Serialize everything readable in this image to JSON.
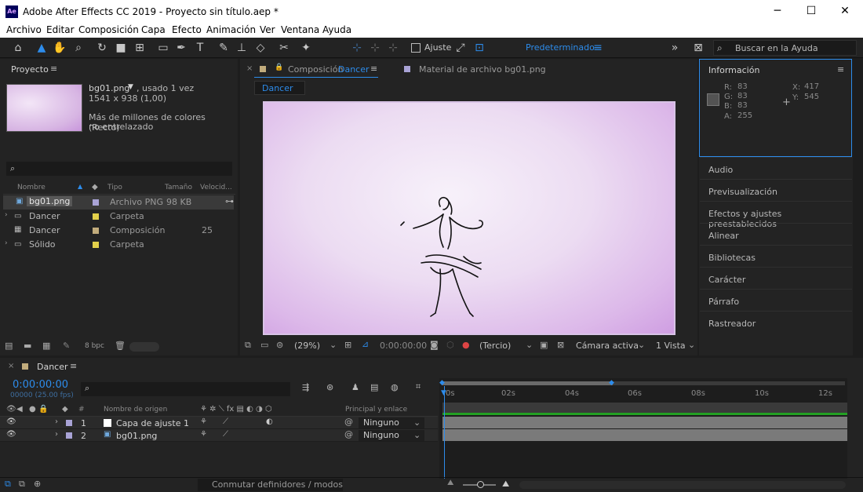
{
  "window": {
    "title": "Adobe After Effects CC 2019 - Proyecto sin título.aep *",
    "logo": "Ae",
    "minimize": "─",
    "maximize": "☐",
    "close": "✕"
  },
  "menu": [
    "Archivo",
    "Editar",
    "Composición",
    "Capa",
    "Efecto",
    "Animación",
    "Ver",
    "Ventana",
    "Ayuda"
  ],
  "toolbar": {
    "snap_label": "Ajuste",
    "workspace": "Predeterminado",
    "search_placeholder": "Buscar en la Ayuda"
  },
  "project": {
    "title": "Proyecto",
    "selected_name": "bg01.png",
    "used": ", usado 1 vez",
    "dimensions": "1541 x 938 (1,00)",
    "color_info": "Más de millones de colores (Recto)",
    "interlace": "no entrelazado",
    "columns": {
      "name": "Nombre",
      "type": "Tipo",
      "size": "Tamaño",
      "speed": "Velocid..."
    },
    "items": [
      {
        "name": "bg01.png",
        "type": "Archivo PNG",
        "size": "98 KB",
        "color": "#a9a3d6"
      },
      {
        "name": "Dancer",
        "type": "Carpeta",
        "size": "",
        "color": "#e2d04a"
      },
      {
        "name": "Dancer",
        "type": "Composición",
        "size": "25",
        "color": "#c2ac7c"
      },
      {
        "name": "Sólido",
        "type": "Carpeta",
        "size": "",
        "color": "#e2d04a"
      }
    ],
    "bpc": "8 bpc"
  },
  "viewer": {
    "tab_comp_prefix": "Composición",
    "tab_comp_name": "Dancer",
    "tab_footage": "Material de archivo  bg01.png",
    "breadcrumb": "Dancer",
    "zoom": "(29%)",
    "timecode": "0:00:00:00",
    "resolution": "(Tercio)",
    "camera": "Cámara activa",
    "views": "1 Vista"
  },
  "info": {
    "title": "Información",
    "r_label": "R:",
    "r": "83",
    "g_label": "G:",
    "g": "83",
    "b_label": "B:",
    "b": "83",
    "a_label": "A:",
    "a": "255",
    "x_label": "X:",
    "x": "417",
    "y_label": "Y:",
    "y": "545"
  },
  "right_panels": [
    "Audio",
    "Previsualización",
    "Efectos y ajustes preestablecidos",
    "Alinear",
    "Bibliotecas",
    "Carácter",
    "Párrafo",
    "Rastreador"
  ],
  "timeline": {
    "tab": "Dancer",
    "timecode": "0:00:00:00",
    "frame_info": "00000 (25.00 fps)",
    "col_hash": "#",
    "col_source": "Nombre de origen",
    "col_parent": "Principal y enlace",
    "layers": [
      {
        "num": "1",
        "name": "Capa de ajuste 1",
        "parent": "Ninguno",
        "color": "#a9a3d6"
      },
      {
        "num": "2",
        "name": "bg01.png",
        "parent": "Ninguno",
        "color": "#a9a3d6"
      }
    ],
    "ruler": [
      "0s",
      "02s",
      "04s",
      "06s",
      "08s",
      "10s",
      "12s"
    ],
    "footer_label": "Conmutar definidores / modos"
  }
}
